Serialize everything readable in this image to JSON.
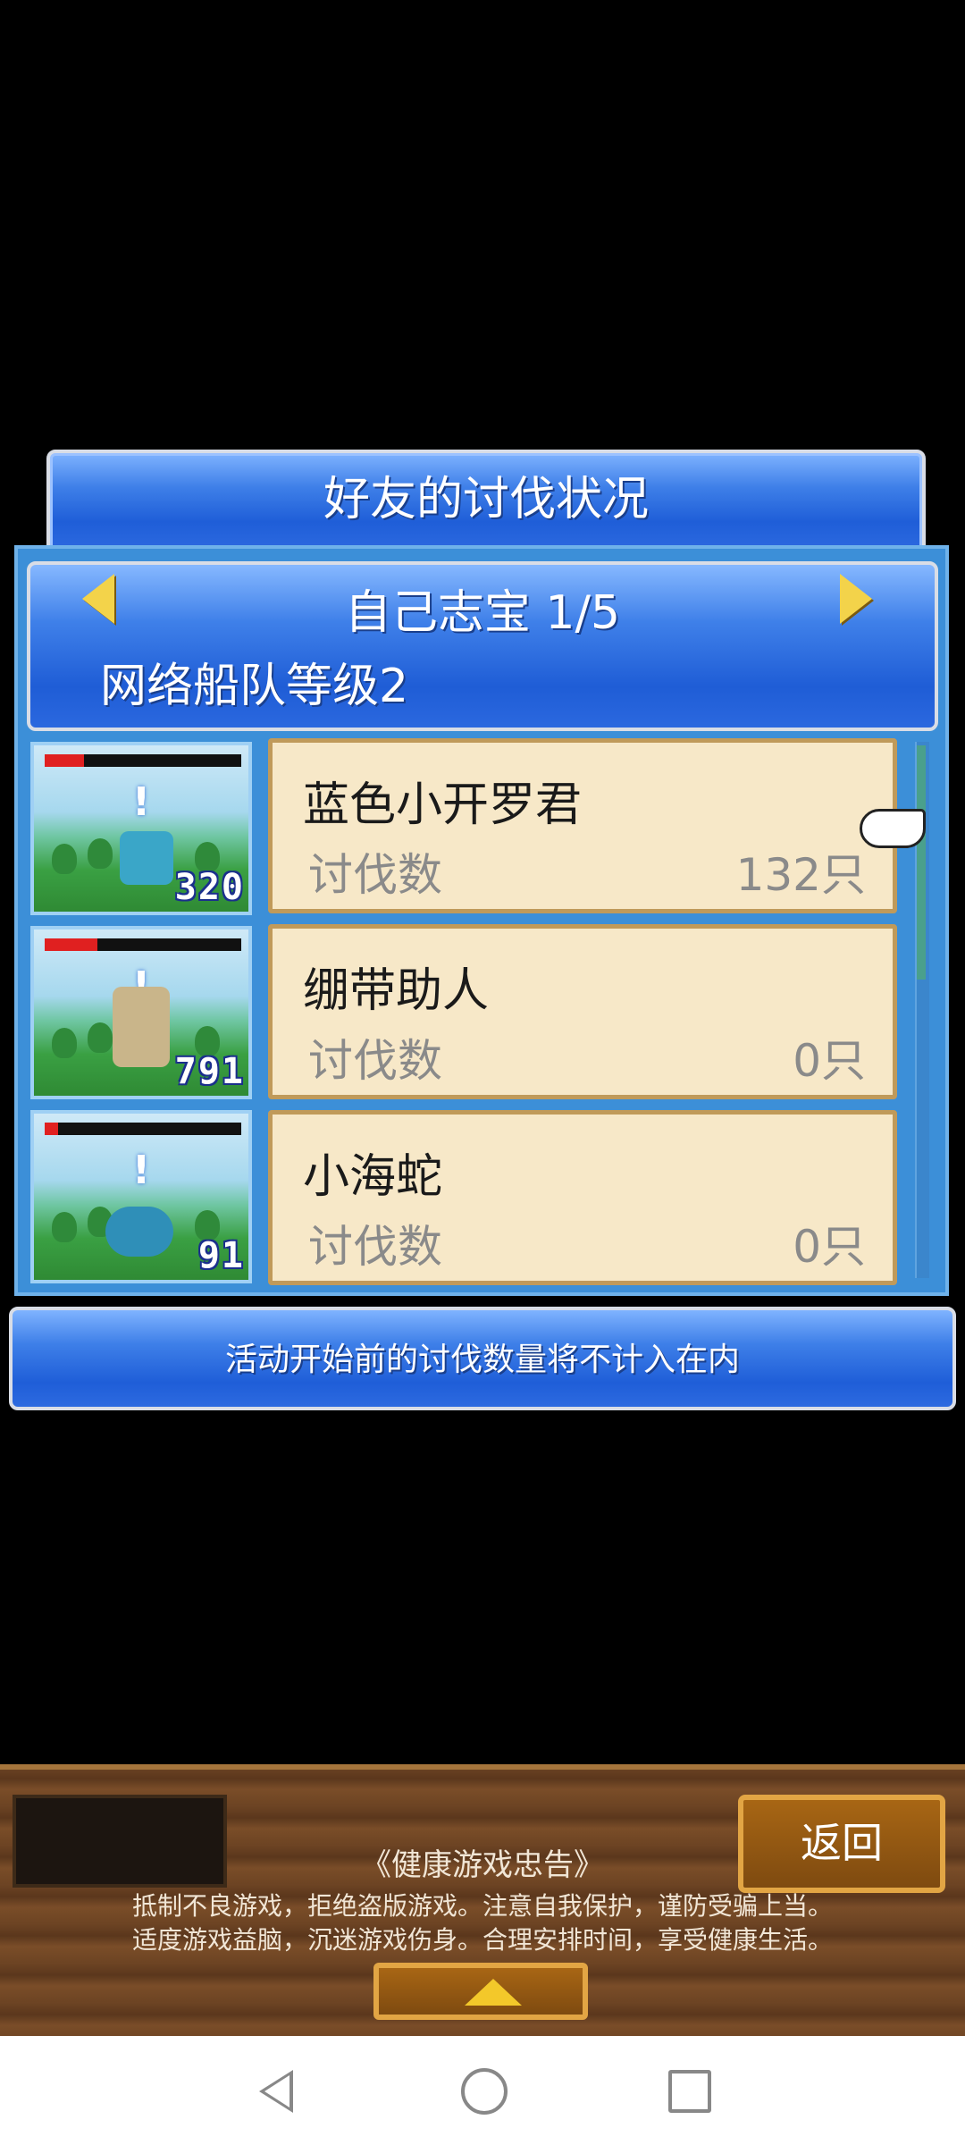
{
  "header": {
    "title": "好友的讨伐状况"
  },
  "friend": {
    "name_page": "自己志宝 1/5",
    "level": "网络船队等级2"
  },
  "list": {
    "items": [
      {
        "name": "蓝色小开罗君",
        "label": "讨伐数",
        "count": "132只",
        "badge": "320",
        "hp_fraction": 0.2,
        "hp_color": "#e02020",
        "monster_color": "#3aa6c8"
      },
      {
        "name": "绷带助人",
        "label": "讨伐数",
        "count": "0只",
        "badge": "791",
        "hp_fraction": 0.27,
        "hp_color": "#e02020",
        "monster_color": "#c9b58a"
      },
      {
        "name": "小海蛇",
        "label": "讨伐数",
        "count": "0只",
        "badge": "91",
        "hp_fraction": 0.07,
        "hp_color": "#e02020",
        "monster_color": "#2f8fb8"
      }
    ]
  },
  "notice": {
    "text": "活动开始前的讨伐数量将不计入在内"
  },
  "bottom": {
    "back_label": "返回",
    "health_title": "《健康游戏忠告》",
    "health_line1": "抵制不良游戏，拒绝盗版游戏。注意自我保护，谨防受骗上当。",
    "health_line2": "适度游戏益脑，沉迷游戏伤身。合理安排时间，享受健康生活。"
  },
  "colors": {
    "panel": "#3c8fd8",
    "card": "#f7e8c8",
    "accent": "#f3d34a"
  }
}
